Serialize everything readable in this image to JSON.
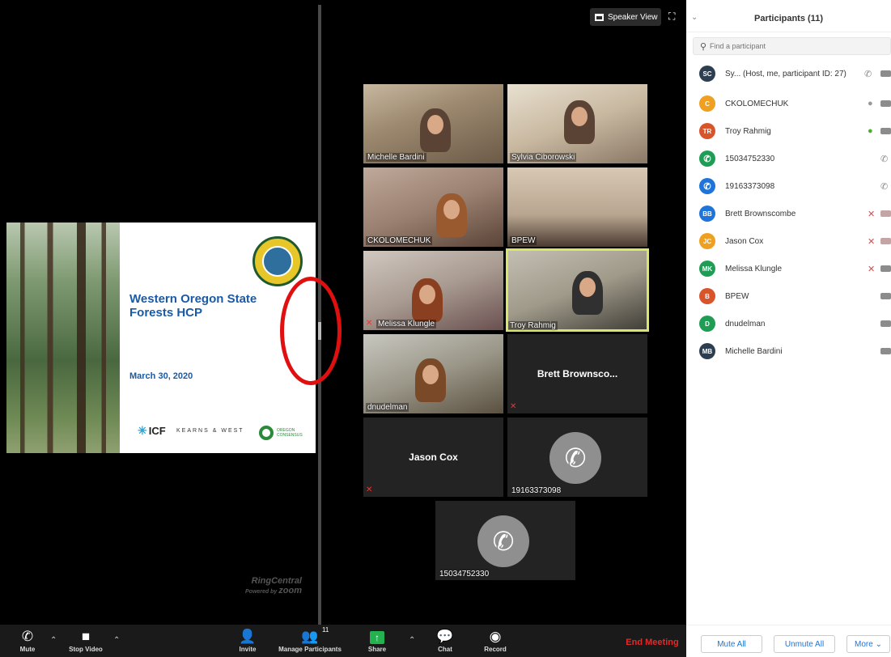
{
  "view": {
    "speaker_view_label": "Speaker View"
  },
  "slide": {
    "title": "Western Oregon State Forests HCP",
    "date": "March 30, 2020",
    "logo_icf": "ICF",
    "logo_kw": "KEARNS & WEST",
    "logo_oc": "OREGON CONSENSUS"
  },
  "branding": {
    "name": "RingCentral",
    "powered_by": "Powered by",
    "zoom": "zoom"
  },
  "gallery": [
    {
      "label": "Michelle Bardini",
      "kind": "video"
    },
    {
      "label": "Sylvia Ciborowski",
      "kind": "video"
    },
    {
      "label": "CKOLOMECHUK",
      "kind": "video"
    },
    {
      "label": "BPEW",
      "kind": "video"
    },
    {
      "label": "Melissa Klungle",
      "kind": "video"
    },
    {
      "label": "Troy Rahmig",
      "kind": "video"
    },
    {
      "label": "dnudelman",
      "kind": "video"
    },
    {
      "label": "Brett  Brownsco...",
      "kind": "name"
    },
    {
      "label": "Jason Cox",
      "kind": "name"
    },
    {
      "label": "19163373098",
      "kind": "phone"
    },
    {
      "label": "15034752330",
      "kind": "phone"
    }
  ],
  "panel": {
    "title": "Participants (11)",
    "search_placeholder": "Find a participant",
    "participants": [
      {
        "initials": "SC",
        "name": "Sy... (Host, me, participant ID: 27)",
        "color": "#2c3e50"
      },
      {
        "initials": "C",
        "name": "CKOLOMECHUK",
        "color": "#f0a020"
      },
      {
        "initials": "TR",
        "name": "Troy Rahmig",
        "color": "#d8542a"
      },
      {
        "initials": "",
        "name": "15034752330",
        "color": "#1f9d55"
      },
      {
        "initials": "",
        "name": "19163373098",
        "color": "#1e74d8"
      },
      {
        "initials": "BB",
        "name": "Brett Brownscombe",
        "color": "#1e74d8"
      },
      {
        "initials": "JC",
        "name": "Jason Cox",
        "color": "#f0a020"
      },
      {
        "initials": "MK",
        "name": "Melissa Klungle",
        "color": "#1f9d55"
      },
      {
        "initials": "B",
        "name": "BPEW",
        "color": "#d8542a"
      },
      {
        "initials": "D",
        "name": "dnudelman",
        "color": "#1f9d55"
      },
      {
        "initials": "MB",
        "name": "Michelle Bardini",
        "color": "#2c3e50"
      }
    ],
    "mute_all": "Mute All",
    "unmute_all": "Unmute All",
    "more": "More ⌄"
  },
  "toolbar": {
    "mute": "Mute",
    "stop_video": "Stop Video",
    "invite": "Invite",
    "manage_participants": "Manage Participants",
    "participant_count": "11",
    "share": "Share",
    "chat": "Chat",
    "record": "Record",
    "end_meeting": "End Meeting"
  },
  "colors": {
    "accent": "#1e74d8",
    "end_meeting": "#e02b2b",
    "share_green": "#23b24f",
    "annotation_red": "#e01010",
    "active_speaker": "#d9e66a"
  }
}
